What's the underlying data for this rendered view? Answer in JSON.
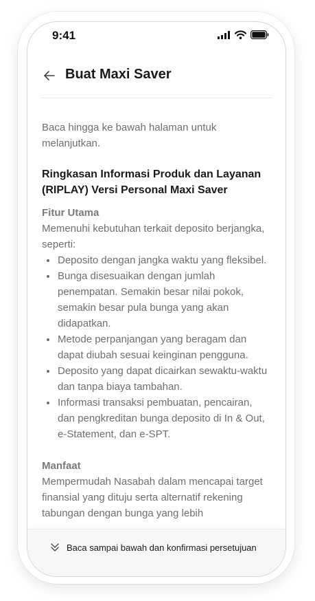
{
  "status_bar": {
    "time": "9:41"
  },
  "header": {
    "title": "Buat Maxi Saver",
    "back_icon": "arrow-left-icon"
  },
  "content": {
    "intro": "Baca hingga ke bawah halaman untuk melanjutkan.",
    "section_title": "Ringkasan Informasi Produk dan Layanan (RIPLAY) Versi Personal Maxi Saver",
    "fitur": {
      "title": "Fitur Utama",
      "description": "Memenuhi kebutuhan terkait deposito berjangka, seperti:",
      "items": [
        "Deposito dengan jangka waktu yang fleksibel.",
        "Bunga disesuaikan dengan jumlah penempatan. Semakin besar nilai pokok, semakin besar pula bunga yang akan didapatkan.",
        "Metode perpanjangan yang beragam dan dapat diubah sesuai keinginan pengguna.",
        "Deposito yang dapat dicairkan sewaktu-waktu dan tanpa biaya tambahan.",
        "Informasi transaksi pembuatan, pencairan, dan pengkreditan bunga deposito di In & Out, e-Statement, dan e-SPT."
      ]
    },
    "manfaat": {
      "title": "Manfaat",
      "description": "Mempermudah Nasabah dalam mencapai target finansial yang dituju serta alternatif rekening tabungan dengan bunga yang lebih"
    }
  },
  "bottom_bar": {
    "label": "Baca sampai bawah dan konfirmasi persetujuan",
    "icon": "double-chevron-down-icon"
  }
}
